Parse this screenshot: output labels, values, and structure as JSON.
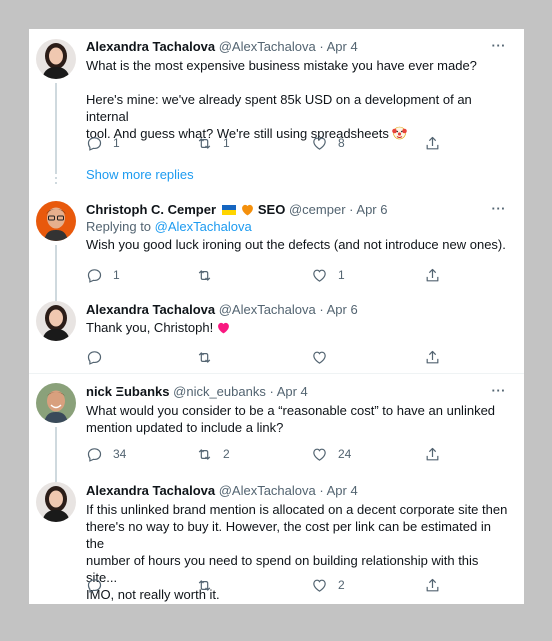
{
  "tweets": [
    {
      "author": "Alexandra Tachalova",
      "handle": "@AlexTachalova",
      "date": "Apr 4",
      "text_line1": "What is the most expensive business mistake you have ever made?",
      "text_line2": "Here's mine: we've already spent 85k USD on a development of an internal",
      "text_line3": "tool. And guess what? We're still using spreadsheets",
      "emoji": "clown-face",
      "replies": "1",
      "retweets": "1",
      "likes": "8"
    },
    {
      "author": "Christoph C. Cemper",
      "author_suffix": "SEO",
      "handle": "@cemper",
      "date": "Apr 6",
      "replying_label": "Replying to",
      "replying_to": "@AlexTachalova",
      "text": "Wish you good luck ironing out the defects (and not introduce new ones).",
      "replies": "1",
      "retweets": "",
      "likes": "1"
    },
    {
      "author": "Alexandra Tachalova",
      "handle": "@AlexTachalova",
      "date": "Apr 6",
      "text": "Thank you, Christoph!",
      "emoji": "heart",
      "replies": "",
      "retweets": "",
      "likes": ""
    },
    {
      "author": "nick Ξubanks",
      "handle": "@nick_eubanks",
      "date": "Apr 4",
      "text_line1": "What would you consider to be a “reasonable cost” to have an unlinked",
      "text_line2": "mention updated to include a link?",
      "replies": "34",
      "retweets": "2",
      "likes": "24"
    },
    {
      "author": "Alexandra Tachalova",
      "handle": "@AlexTachalova",
      "date": "Apr 4",
      "text_line1": "If this unlinked brand mention is allocated on a decent corporate site then",
      "text_line2": "there's no way to buy it. However, the cost per link can be estimated in the",
      "text_line3": "number of hours you need to spend on building relationship with this site...",
      "text_line4": "IMO, not really worth it.",
      "replies": "",
      "retweets": "",
      "likes": "2"
    }
  ],
  "show_more_replies": "Show more replies",
  "more_menu": "···",
  "separator": "·",
  "colors": {
    "link": "#1d9bf0",
    "heart": "#f91880",
    "text": "#0f1419",
    "muted": "#536471"
  }
}
